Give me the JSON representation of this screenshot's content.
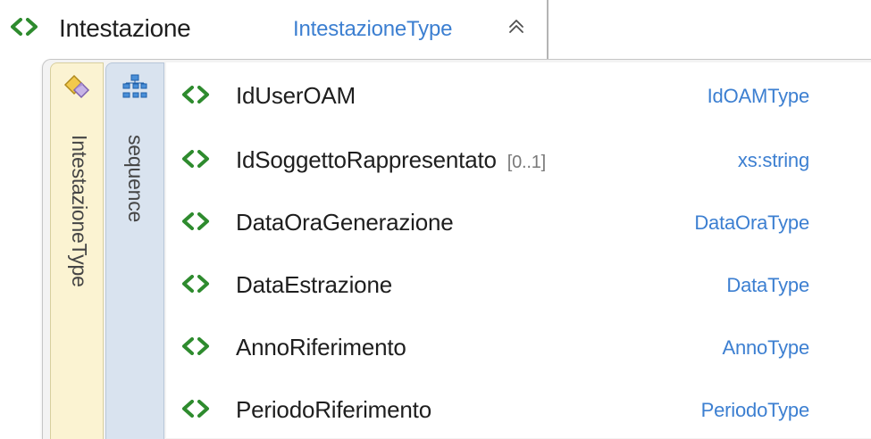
{
  "header": {
    "name": "Intestazione",
    "type": "IntestazioneType",
    "icon": "element-icon",
    "collapse_icon": "collapse-up-icon"
  },
  "complex_type": {
    "label": "IntestazioneType",
    "icon": "complex-type-icon"
  },
  "sequence": {
    "label": "sequence",
    "icon": "sequence-icon"
  },
  "items": [
    {
      "name": "IdUserOAM",
      "cardinality": "",
      "type": "IdOAMType"
    },
    {
      "name": "IdSoggettoRappresentato",
      "cardinality": "[0..1]",
      "type": "xs:string"
    },
    {
      "name": "DataOraGenerazione",
      "cardinality": "",
      "type": "DataOraType"
    },
    {
      "name": "DataEstrazione",
      "cardinality": "",
      "type": "DataType"
    },
    {
      "name": "AnnoRiferimento",
      "cardinality": "",
      "type": "AnnoType"
    },
    {
      "name": "PeriodoRiferimento",
      "cardinality": "",
      "type": "PeriodoType"
    }
  ],
  "colors": {
    "element_icon": "#2e8b2e",
    "type_text": "#3c7fd1",
    "complex_type_bg": "#fbf3d2",
    "sequence_bg": "#d9e3ef"
  }
}
